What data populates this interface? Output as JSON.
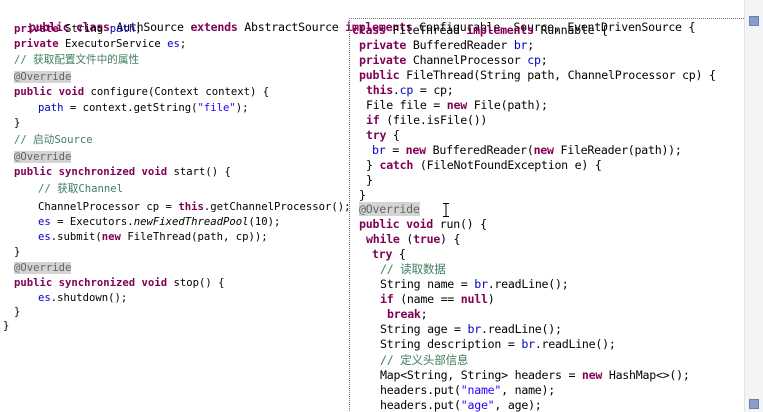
{
  "header_line": {
    "kw1": "public class",
    "name": " AuthSource ",
    "kw2": "extends",
    "parent": " AbstractSource ",
    "kw3": "implements",
    "ifaces": " Configurable, Source, EventDrivenSource {"
  },
  "left": {
    "l1_kw": "private",
    "l1_txt": " String ",
    "l1_fld": "path",
    "l1_end": ";",
    "l2_kw": "private",
    "l2_txt": " ExecutorService ",
    "l2_fld": "es",
    "l2_end": ";",
    "l3_cmt": "// 获取配置文件中的属性",
    "l4_ann": "@Override",
    "l5_kw": "public void",
    "l5_txt": " configure(Context context) {",
    "l6_fld": "path",
    "l6_txt": " = context.getString(",
    "l6_str": "\"file\"",
    "l6_end": ");",
    "l7": "}",
    "l8_cmt": "// 启动Source",
    "l9_ann": "@Override",
    "l10_kw": "public synchronized void",
    "l10_txt": " start() {",
    "l11_cmt": "// 获取Channel",
    "l12_txt": "ChannelProcessor cp = ",
    "l12_kw": "this",
    "l12_end": ".getChannelProcessor();",
    "l13_fld": "es",
    "l13_txt": " = Executors.",
    "l13_ital": "newFixedThreadPool",
    "l13_end": "(10);",
    "l14_fld": "es",
    "l14_txt": ".submit(",
    "l14_kw": "new",
    "l14_end": " FileThread(path, cp));",
    "l15": "}",
    "l16_ann": "@Override",
    "l17_kw": "public synchronized void",
    "l17_txt": " stop() {",
    "l18_fld": "es",
    "l18_txt": ".shutdown();",
    "l19": "}",
    "l20": "}"
  },
  "right": {
    "r1_kw": "class",
    "r1_txt": " FileThread ",
    "r1_kw2": "implements",
    "r1_end": " Runnable {",
    "r2_kw": "private",
    "r2_txt": " BufferedReader ",
    "r2_fld": "br",
    "r2_end": ";",
    "r3_kw": "private",
    "r3_txt": " ChannelProcessor ",
    "r3_fld": "cp",
    "r3_end": ";",
    "r4_kw": "public",
    "r4_txt": " FileThread(String path, ChannelProcessor cp) {",
    "r5_kw": "this",
    "r5_dot": ".",
    "r5_fld": "cp",
    "r5_end": " = cp;",
    "r6_txt": "File file = ",
    "r6_kw": "new",
    "r6_end": " File(path);",
    "r7_kw": "if",
    "r7_end": " (file.isFile())",
    "r8_kw": "try",
    "r8_end": " {",
    "r9_fld": "br",
    "r9_txt": " = ",
    "r9_kw": "new",
    "r9_mid": " BufferedReader(",
    "r9_kw2": "new",
    "r9_end": " FileReader(path));",
    "r10_a": "} ",
    "r10_kw": "catch",
    "r10_end": " (FileNotFoundException e) {",
    "r11": "}",
    "r12": "}",
    "r13_ann": "@Override",
    "r14_kw": "public void",
    "r14_end": " run() {",
    "r15_kw": "while",
    "r15_mid": " (",
    "r15_kw2": "true",
    "r15_end": ") {",
    "r16_kw": "try",
    "r16_end": " {",
    "r17_cmt": "// 读取数据",
    "r18_txt": "String name = ",
    "r18_fld": "br",
    "r18_end": ".readLine();",
    "r19_kw": "if",
    "r19_mid": " (name == ",
    "r19_kw2": "null",
    "r19_end": ")",
    "r20_kw": "break",
    "r20_end": ";",
    "r21_txt": "String age = ",
    "r21_fld": "br",
    "r21_end": ".readLine();",
    "r22_txt": "String description = ",
    "r22_fld": "br",
    "r22_end": ".readLine();",
    "r23_cmt": "// 定义头部信息",
    "r24_txt": "Map<String, String> headers = ",
    "r24_kw": "new",
    "r24_end": " HashMap<>();",
    "r25_txt": "headers.put(",
    "r25_str": "\"name\"",
    "r25_end": ", name);",
    "r26_txt": "headers.put(",
    "r26_str": "\"age\"",
    "r26_end": ", age);"
  },
  "colors": {
    "keyword": "#7f0055",
    "field": "#0000c0",
    "string": "#2a00ff",
    "comment": "#3f7f5f",
    "annotation": "#646464"
  }
}
